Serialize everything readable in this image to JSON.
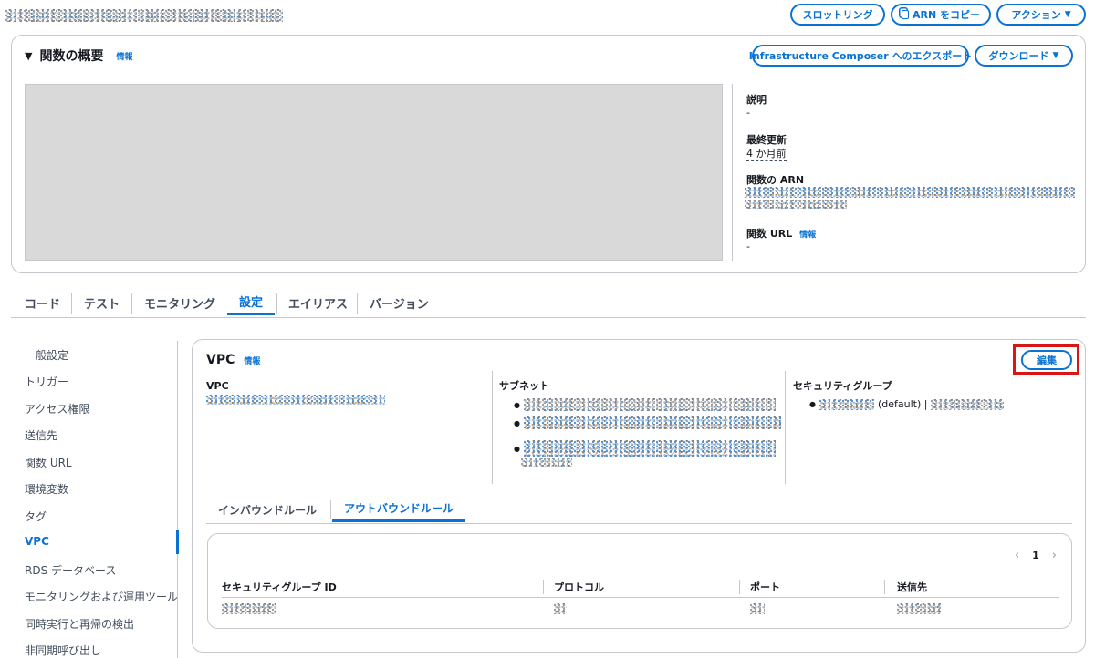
{
  "header": {
    "buttons": {
      "throttle": "スロットリング",
      "copy_arn": "ARN をコピー",
      "actions": "アクション"
    }
  },
  "overview": {
    "title": "関数の概要",
    "info": "情報",
    "export": "Infrastructure Composer へのエクスポート",
    "download": "ダウンロード",
    "description_label": "説明",
    "description_value": "-",
    "last_modified_label": "最終更新",
    "last_modified_value": "4 か月前",
    "arn_label": "関数の ARN",
    "url_label": "関数 URL",
    "url_info": "情報",
    "url_value": "-"
  },
  "tabs": [
    {
      "label": "コード"
    },
    {
      "label": "テスト"
    },
    {
      "label": "モニタリング"
    },
    {
      "label": "設定"
    },
    {
      "label": "エイリアス"
    },
    {
      "label": "バージョン"
    }
  ],
  "active_tab": "設定",
  "sidebar": {
    "items": [
      {
        "label": "一般設定"
      },
      {
        "label": "トリガー"
      },
      {
        "label": "アクセス権限"
      },
      {
        "label": "送信先"
      },
      {
        "label": "関数 URL"
      },
      {
        "label": "環境変数"
      },
      {
        "label": "タグ"
      },
      {
        "label": "VPC"
      },
      {
        "label": "RDS データベース"
      },
      {
        "label": "モニタリングおよび運用ツール"
      },
      {
        "label": "同時実行と再帰の検出"
      },
      {
        "label": "非同期呼び出し"
      }
    ],
    "active": "VPC"
  },
  "vpc": {
    "title": "VPC",
    "info": "情報",
    "edit": "編集",
    "vpc_label": "VPC",
    "subnet_label": "サブネット",
    "sg_label": "セキュリティグループ",
    "sg_default": "(default) |",
    "rule_tabs": {
      "inbound": "インバウンドルール",
      "outbound": "アウトバウンドルール"
    },
    "pagination": {
      "prev": "‹",
      "page": "1",
      "next": "›"
    },
    "table": {
      "headers": [
        "セキュリティグループ ID",
        "プロトコル",
        "ポート",
        "送信先"
      ]
    }
  },
  "colors": {
    "accent": "#0972d3",
    "highlight_box": "#d91515",
    "border": "#c6c6cd",
    "placeholder_gray": "#d9d9d9"
  }
}
